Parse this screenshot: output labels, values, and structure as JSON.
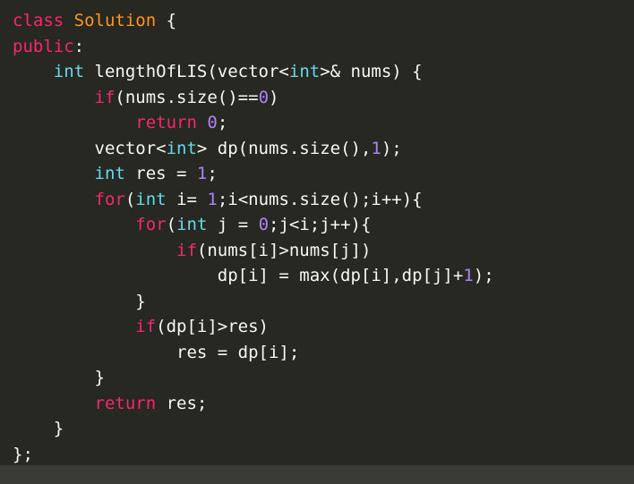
{
  "editor": {
    "language": "cpp",
    "background_color": "#272822",
    "default_text_color": "#F8F8F2",
    "theme_name": "monokai",
    "font_size_px": 19,
    "line_height_px": 28.5
  },
  "palette": {
    "keyword": "#F92672",
    "type": "#66D9EF",
    "class_name": "#FD971F",
    "number": "#AE81FF",
    "plain": "#F8F8F2",
    "scrollbar_track": "#3b3b35"
  },
  "scrollbar": {
    "orientation": "horizontal",
    "track_color": "#3b3b35",
    "thumb_visible": false
  },
  "code": {
    "full_text": "class Solution {\npublic:\n    int lengthOfLIS(vector<int>& nums) {\n        if(nums.size()==0)\n            return 0;\n        vector<int> dp(nums.size(),1);\n        int res = 1;\n        for(int i= 1;i<nums.size();i++){\n            for(int j = 0;j<i;j++){\n                if(nums[i]>nums[j])\n                    dp[i] = max(dp[i],dp[j]+1);\n            }\n            if(dp[i]>res)\n                res = dp[i];\n        }\n        return res;\n    }\n};",
    "lines": [
      {
        "index": 1,
        "text": "class Solution {",
        "tokens": [
          {
            "t": "class",
            "c": "keyword"
          },
          {
            "t": " ",
            "c": "plain"
          },
          {
            "t": "Solution",
            "c": "class_name"
          },
          {
            "t": " {",
            "c": "plain"
          }
        ]
      },
      {
        "index": 2,
        "text": "public:",
        "tokens": [
          {
            "t": "public",
            "c": "keyword"
          },
          {
            "t": ":",
            "c": "plain"
          }
        ]
      },
      {
        "index": 3,
        "text": "    int lengthOfLIS(vector<int>& nums) {",
        "tokens": [
          {
            "t": "    ",
            "c": "plain"
          },
          {
            "t": "int",
            "c": "type"
          },
          {
            "t": " lengthOfLIS(vector<",
            "c": "plain"
          },
          {
            "t": "int",
            "c": "type"
          },
          {
            "t": ">& nums) {",
            "c": "plain"
          }
        ]
      },
      {
        "index": 4,
        "text": "        if(nums.size()==0)",
        "tokens": [
          {
            "t": "        ",
            "c": "plain"
          },
          {
            "t": "if",
            "c": "keyword"
          },
          {
            "t": "(nums.size()==",
            "c": "plain"
          },
          {
            "t": "0",
            "c": "number"
          },
          {
            "t": ")",
            "c": "plain"
          }
        ]
      },
      {
        "index": 5,
        "text": "            return 0;",
        "tokens": [
          {
            "t": "            ",
            "c": "plain"
          },
          {
            "t": "return",
            "c": "keyword"
          },
          {
            "t": " ",
            "c": "plain"
          },
          {
            "t": "0",
            "c": "number"
          },
          {
            "t": ";",
            "c": "plain"
          }
        ]
      },
      {
        "index": 6,
        "text": "        vector<int> dp(nums.size(),1);",
        "tokens": [
          {
            "t": "        vector<",
            "c": "plain"
          },
          {
            "t": "int",
            "c": "type"
          },
          {
            "t": "> dp(nums.size(),",
            "c": "plain"
          },
          {
            "t": "1",
            "c": "number"
          },
          {
            "t": ");",
            "c": "plain"
          }
        ]
      },
      {
        "index": 7,
        "text": "        int res = 1;",
        "tokens": [
          {
            "t": "        ",
            "c": "plain"
          },
          {
            "t": "int",
            "c": "type"
          },
          {
            "t": " res = ",
            "c": "plain"
          },
          {
            "t": "1",
            "c": "number"
          },
          {
            "t": ";",
            "c": "plain"
          }
        ]
      },
      {
        "index": 8,
        "text": "        for(int i= 1;i<nums.size();i++){",
        "tokens": [
          {
            "t": "        ",
            "c": "plain"
          },
          {
            "t": "for",
            "c": "keyword"
          },
          {
            "t": "(",
            "c": "plain"
          },
          {
            "t": "int",
            "c": "type"
          },
          {
            "t": " i= ",
            "c": "plain"
          },
          {
            "t": "1",
            "c": "number"
          },
          {
            "t": ";i<nums.size();i++){",
            "c": "plain"
          }
        ]
      },
      {
        "index": 9,
        "text": "            for(int j = 0;j<i;j++){",
        "tokens": [
          {
            "t": "            ",
            "c": "plain"
          },
          {
            "t": "for",
            "c": "keyword"
          },
          {
            "t": "(",
            "c": "plain"
          },
          {
            "t": "int",
            "c": "type"
          },
          {
            "t": " j = ",
            "c": "plain"
          },
          {
            "t": "0",
            "c": "number"
          },
          {
            "t": ";j<i;j++){",
            "c": "plain"
          }
        ]
      },
      {
        "index": 10,
        "text": "                if(nums[i]>nums[j])",
        "tokens": [
          {
            "t": "                ",
            "c": "plain"
          },
          {
            "t": "if",
            "c": "keyword"
          },
          {
            "t": "(nums[i]>nums[j])",
            "c": "plain"
          }
        ]
      },
      {
        "index": 11,
        "text": "                    dp[i] = max(dp[i],dp[j]+1);",
        "tokens": [
          {
            "t": "                    dp[i] = max(dp[i],dp[j]+",
            "c": "plain"
          },
          {
            "t": "1",
            "c": "number"
          },
          {
            "t": ");",
            "c": "plain"
          }
        ]
      },
      {
        "index": 12,
        "text": "            }",
        "tokens": [
          {
            "t": "            }",
            "c": "plain"
          }
        ]
      },
      {
        "index": 13,
        "text": "            if(dp[i]>res)",
        "tokens": [
          {
            "t": "            ",
            "c": "plain"
          },
          {
            "t": "if",
            "c": "keyword"
          },
          {
            "t": "(dp[i]>res)",
            "c": "plain"
          }
        ]
      },
      {
        "index": 14,
        "text": "                res = dp[i];",
        "tokens": [
          {
            "t": "                res = dp[i];",
            "c": "plain"
          }
        ]
      },
      {
        "index": 15,
        "text": "        }",
        "tokens": [
          {
            "t": "        }",
            "c": "plain"
          }
        ]
      },
      {
        "index": 16,
        "text": "        return res;",
        "tokens": [
          {
            "t": "        ",
            "c": "plain"
          },
          {
            "t": "return",
            "c": "keyword"
          },
          {
            "t": " res;",
            "c": "plain"
          }
        ]
      },
      {
        "index": 17,
        "text": "    }",
        "tokens": [
          {
            "t": "    }",
            "c": "plain"
          }
        ]
      },
      {
        "index": 18,
        "text": "};",
        "tokens": [
          {
            "t": "};",
            "c": "plain"
          }
        ]
      }
    ]
  }
}
